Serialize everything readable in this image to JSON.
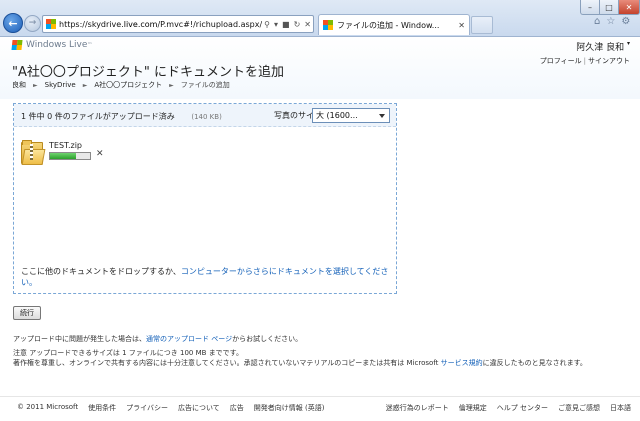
{
  "browser": {
    "url_prefix": "https://skydrive.",
    "url_domain": "live.com",
    "url_rest": "/P.mvc#!/richupload.aspx/A%e",
    "tab_title": "ファイルの追加 - Window...",
    "icons": [
      "back-arrow",
      "forward-arrow",
      "search-icon",
      "refresh-icon",
      "lock-icon",
      "close-icon",
      "home-icon",
      "star-icon",
      "gear-icon"
    ]
  },
  "header": {
    "brand": "Windows Live",
    "user_name": "阿久津 良和",
    "profile_link": "プロフィール",
    "signout_link": "サインアウト",
    "title": "\"A社〇〇プロジェクト\" にドキュメントを追加",
    "breadcrumb": [
      "良和",
      "SkyDrive",
      "A社〇〇プロジェクト",
      "ファイルの追加"
    ]
  },
  "upload": {
    "status": "1 件中 0 件のファイルがアップロード済み",
    "total_size": "(140 KB)",
    "photo_size_label": "写真のサイズ:",
    "photo_size_value": "大 (1600...",
    "files": [
      {
        "name": "TEST.zip",
        "progress": 0.65
      }
    ],
    "drop_text": "ここに他のドキュメントをドロップするか、",
    "drop_link": "コンピューターからさらにドキュメントを選択してください。"
  },
  "continue_label": "続行",
  "notes": {
    "line1_prefix": "アップロード中に問題が発生した場合は、",
    "line1_link": "通常のアップロード ページ",
    "line1_suffix": "からお試しください。",
    "line2": "注意  アップロードできるサイズは 1 ファイルにつき 100 MB までです。",
    "line3_prefix": "著作権を尊重し、オンラインで共有する内容には十分注意してください。承認されていないマテリアルのコピーまたは共有は Microsoft ",
    "line3_link": "サービス規約",
    "line3_suffix": "に違反したものと見なされます。"
  },
  "footer": {
    "left": [
      "© 2011 Microsoft",
      "使用条件",
      "プライバシー",
      "広告について",
      "広告",
      "開発者向け情報 (英語)"
    ],
    "right": [
      "迷惑行為のレポート",
      "倫理規定",
      "ヘルプ センター",
      "ご意見ご感想",
      "日本語"
    ]
  },
  "colors": {
    "link": "#1360b8",
    "upload_border": "#7aa7d6",
    "progress_fill": "#2aa02a",
    "close_button": "#c4422c"
  }
}
